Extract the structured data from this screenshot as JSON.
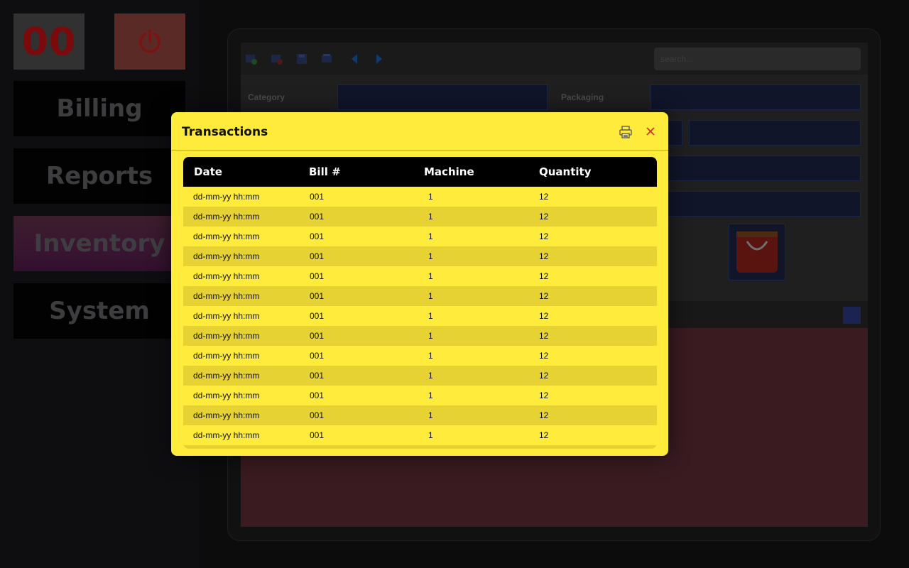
{
  "sidebar": {
    "counter": "00",
    "power_icon": "power-icon",
    "items": [
      {
        "label": "Billing",
        "active": false
      },
      {
        "label": "Reports",
        "active": false
      },
      {
        "label": "Inventory",
        "active": true
      },
      {
        "label": "System",
        "active": false
      }
    ]
  },
  "background": {
    "toolbar_icons": [
      "add-item-icon",
      "delete-item-icon",
      "save-icon",
      "print-icon",
      "previous-icon",
      "next-icon"
    ],
    "search_placeholder": "search...",
    "fields": {
      "category_label": "Category",
      "packaging_label": "Packaging"
    },
    "image_icon": "shopping-bag-icon"
  },
  "modal": {
    "title": "Transactions",
    "print_icon": "printer-icon",
    "close_icon": "close-icon",
    "columns": [
      "Date",
      "Bill #",
      "Machine",
      "Quantity"
    ],
    "rows": [
      [
        "dd-mm-yy hh:mm",
        "001",
        "1",
        "12"
      ],
      [
        "dd-mm-yy hh:mm",
        "001",
        "1",
        "12"
      ],
      [
        "dd-mm-yy hh:mm",
        "001",
        "1",
        "12"
      ],
      [
        "dd-mm-yy hh:mm",
        "001",
        "1",
        "12"
      ],
      [
        "dd-mm-yy hh:mm",
        "001",
        "1",
        "12"
      ],
      [
        "dd-mm-yy hh:mm",
        "001",
        "1",
        "12"
      ],
      [
        "dd-mm-yy hh:mm",
        "001",
        "1",
        "12"
      ],
      [
        "dd-mm-yy hh:mm",
        "001",
        "1",
        "12"
      ],
      [
        "dd-mm-yy hh:mm",
        "001",
        "1",
        "12"
      ],
      [
        "dd-mm-yy hh:mm",
        "001",
        "1",
        "12"
      ],
      [
        "dd-mm-yy hh:mm",
        "001",
        "1",
        "12"
      ],
      [
        "dd-mm-yy hh:mm",
        "001",
        "1",
        "12"
      ],
      [
        "dd-mm-yy hh:mm",
        "001",
        "1",
        "12"
      ]
    ]
  },
  "colors": {
    "modal_bg": "#ffeb3b",
    "row_alt": "#e6d233",
    "header_bg": "#000000",
    "close_accent": "#d32f2f"
  }
}
